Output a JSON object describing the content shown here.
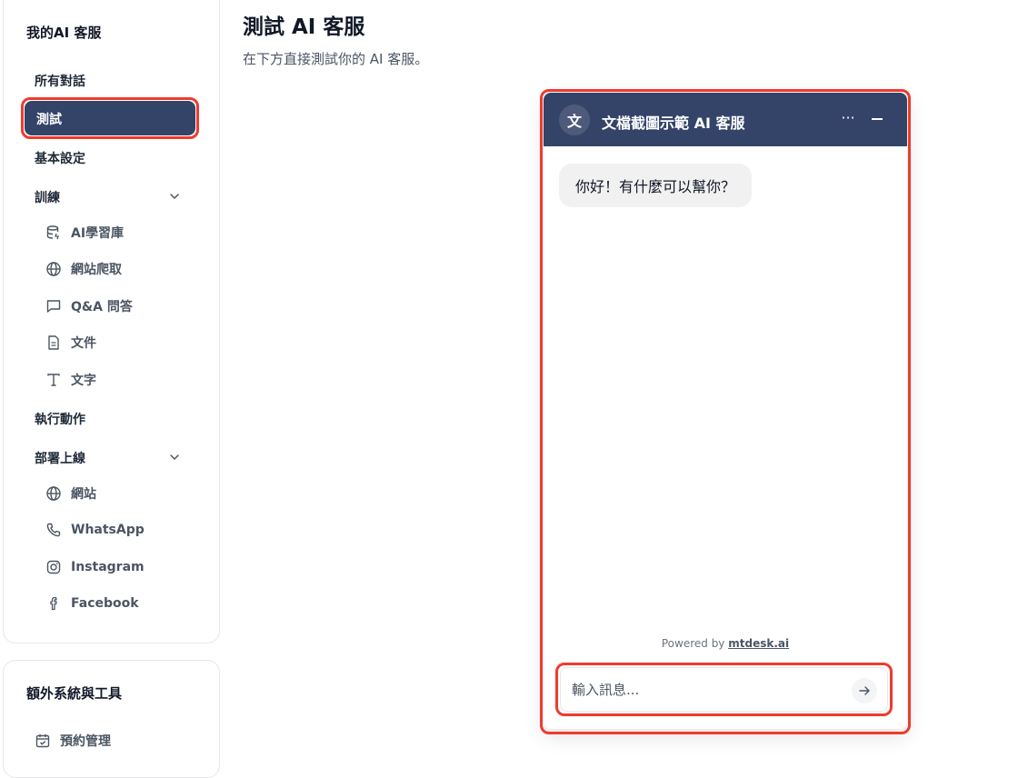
{
  "sidebar": {
    "title": "我的AI 客服",
    "items": {
      "all_conversations": "所有對話",
      "test": "測試",
      "basic_settings": "基本設定",
      "training": "訓練",
      "actions": "執行動作",
      "deploy": "部署上線"
    },
    "training_sub": [
      {
        "label": "AI學習庫",
        "icon": "database-icon"
      },
      {
        "label": "網站爬取",
        "icon": "globe-icon"
      },
      {
        "label": "Q&A 問答",
        "icon": "chat-bubble-icon"
      },
      {
        "label": "文件",
        "icon": "document-icon"
      },
      {
        "label": "文字",
        "icon": "text-icon"
      }
    ],
    "deploy_sub": [
      {
        "label": "網站",
        "icon": "globe-icon"
      },
      {
        "label": "WhatsApp",
        "icon": "phone-icon"
      },
      {
        "label": "Instagram",
        "icon": "instagram-icon"
      },
      {
        "label": "Facebook",
        "icon": "facebook-icon"
      }
    ],
    "extra": {
      "title": "額外系統與工具",
      "items": [
        {
          "label": "預約管理",
          "icon": "calendar-check-icon"
        }
      ]
    }
  },
  "main": {
    "title": "測試 AI 客服",
    "subtitle": "在下方直接測試你的 AI 客服。"
  },
  "widget": {
    "avatar_letter": "文",
    "title": "文檔截圖示範 AI 客服",
    "more_label": "···",
    "greeting": "你好！有什麼可以幫你？",
    "powered_prefix": "Powered by",
    "powered_brand": "mtdesk.ai",
    "input_placeholder": "輸入訊息...",
    "input_value": ""
  },
  "colors": {
    "accent": "#344469",
    "highlight": "#ef3b2d"
  }
}
